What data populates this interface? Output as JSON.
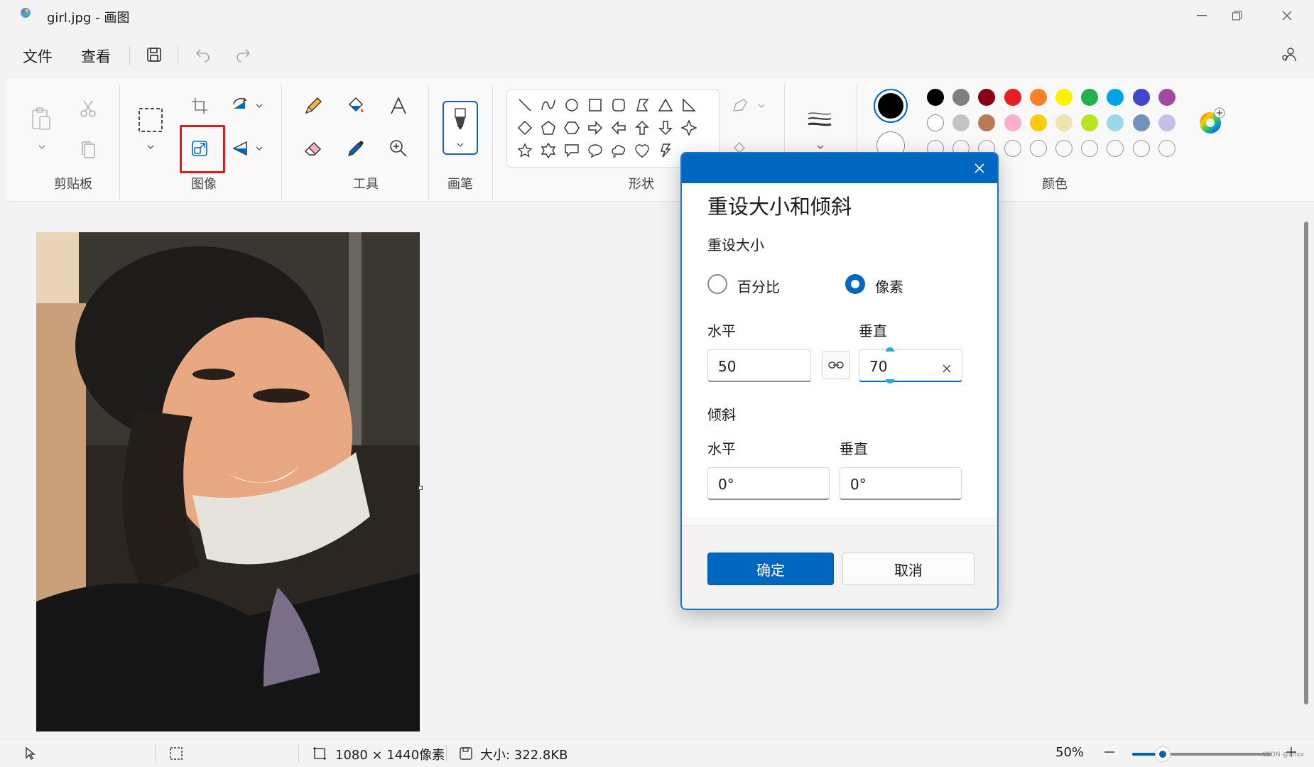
{
  "window": {
    "title": "girl.jpg - 画图"
  },
  "menu": {
    "items": [
      "文件",
      "查看"
    ]
  },
  "ribbon": {
    "groups": {
      "clipboard": "剪贴板",
      "image": "图像",
      "tools": "工具",
      "brush": "画笔",
      "shapes": "形状",
      "colors": "颜色"
    },
    "palette": {
      "primary": "#000000",
      "secondary": "#ffffff",
      "row1": [
        "#000000",
        "#7f7f7f",
        "#880015",
        "#ed1c24",
        "#ff7f27",
        "#fff200",
        "#22b14c",
        "#00a2e8",
        "#3f48cc",
        "#a349a4"
      ],
      "row2": [
        "#ffffff",
        "#c3c3c3",
        "#b97a57",
        "#ffaec9",
        "#ffc90e",
        "#efe4b0",
        "#b5e61d",
        "#99d9ea",
        "#7092be",
        "#c8bfe7"
      ]
    }
  },
  "dialog": {
    "title": "重设大小和倾斜",
    "resize_section": "重设大小",
    "option_percent": "百分比",
    "option_pixels": "像素",
    "selected_option": "像素",
    "horizontal_label": "水平",
    "vertical_label": "垂直",
    "horizontal_value": "50",
    "vertical_value": "70",
    "skew_section": "倾斜",
    "skew_horizontal_label": "水平",
    "skew_vertical_label": "垂直",
    "skew_horizontal_value": "0°",
    "skew_vertical_value": "0°",
    "ok_label": "确定",
    "cancel_label": "取消"
  },
  "status": {
    "dimensions": "1080 × 1440像素",
    "size": "大小: 322.8KB",
    "zoom": "50%",
    "zoom_level": 0.22
  },
  "watermark": "CSDN @xnxx"
}
